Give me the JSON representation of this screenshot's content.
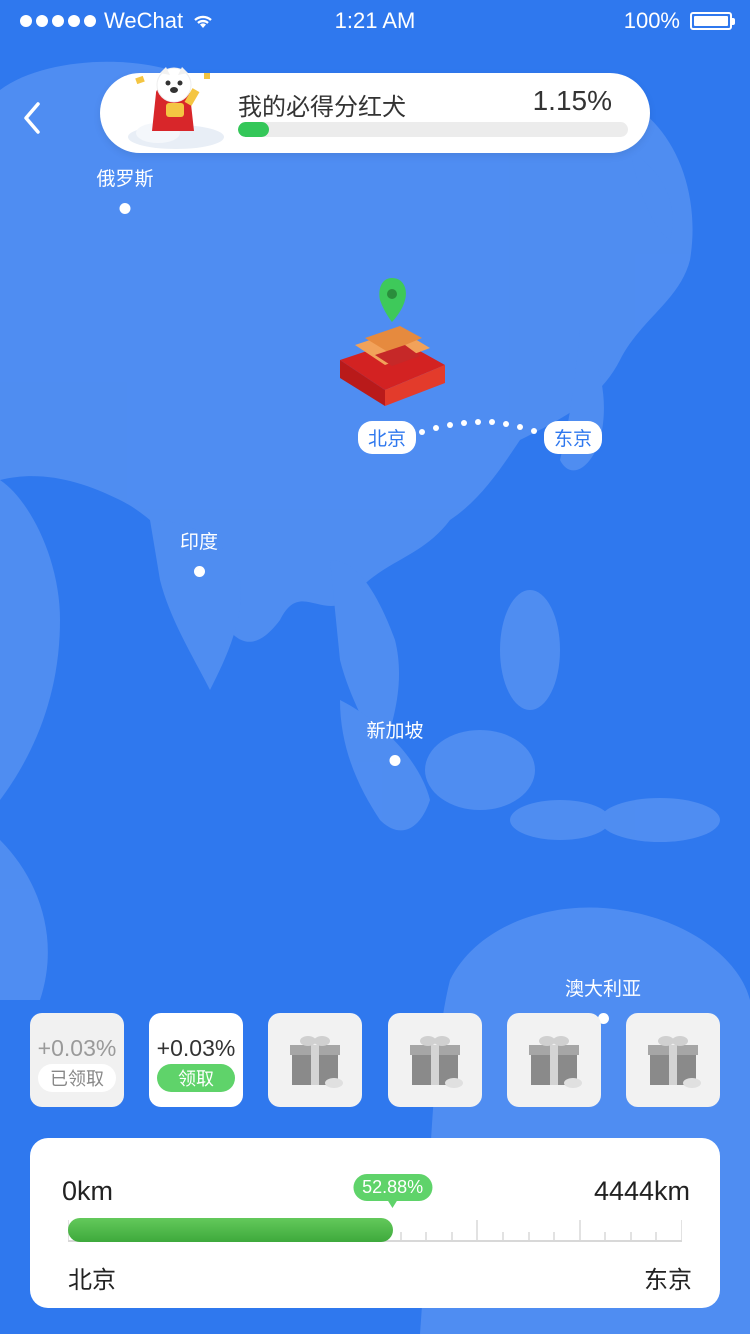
{
  "status_bar": {
    "carrier": "WeChat",
    "time": "1:21 AM",
    "battery": "100%"
  },
  "header": {
    "title": "我的必得分红犬",
    "percent": "1.15%",
    "progress": 0.08
  },
  "map": {
    "cities": {
      "russia": "俄罗斯",
      "india": "印度",
      "singapore": "新加坡",
      "australia": "澳大利亚"
    },
    "route": {
      "from": "北京",
      "to": "东京"
    }
  },
  "rewards": [
    {
      "value": "+0.03%",
      "action": "已领取",
      "state": "claimed"
    },
    {
      "value": "+0.03%",
      "action": "领取",
      "state": "available"
    },
    {
      "state": "locked"
    },
    {
      "state": "locked"
    },
    {
      "state": "locked"
    },
    {
      "state": "locked"
    }
  ],
  "trip": {
    "start_km": "0km",
    "end_km": "4444km",
    "progress_label": "52.88%",
    "progress": 0.5288,
    "from": "北京",
    "to": "东京"
  },
  "colors": {
    "background": "#2f78ee",
    "accent_green": "#5fd36a",
    "land": "#5c95f3"
  }
}
